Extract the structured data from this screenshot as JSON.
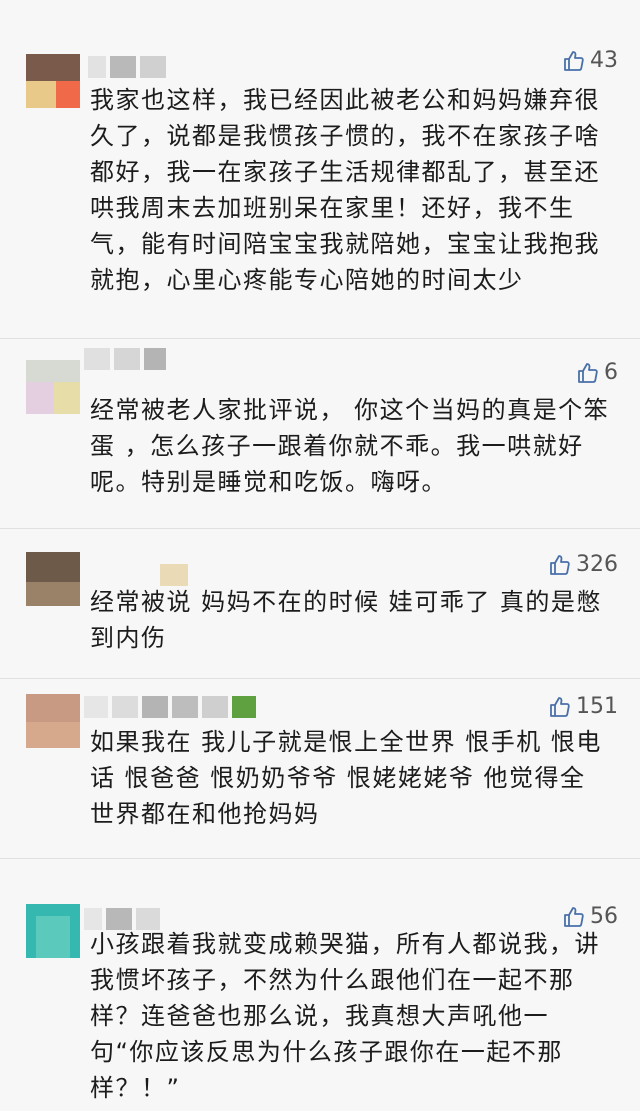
{
  "comments": [
    {
      "likes": "43",
      "text": "我家也这样，我已经因此被老公和妈妈嫌弃很久了，说都是我惯孩子惯的，我不在家孩子啥都好，我一在家孩子生活规律都乱了，甚至还哄我周末去加班别呆在家里！还好，我不生气，能有时间陪宝宝我就陪她，宝宝让我抱我就抱，心里心疼能专心陪她的时间太少"
    },
    {
      "likes": "6",
      "text": "经常被老人家批评说， 你这个当妈的真是个笨蛋 ，怎么孩子一跟着你就不乖。我一哄就好呢。特别是睡觉和吃饭。嗨呀。"
    },
    {
      "likes": "326",
      "text": "经常被说 妈妈不在的时候 娃可乖了 真的是憋到内伤"
    },
    {
      "likes": "151",
      "text": "如果我在 我儿子就是恨上全世界 恨手机 恨电话 恨爸爸 恨奶奶爷爷 恨姥姥姥爷 他觉得全世界都在和他抢妈妈"
    },
    {
      "likes": "56",
      "text": "小孩跟着我就变成赖哭猫，所有人都说我，讲我惯坏孩子，不然为什么跟他们在一起不那样？连爸爸也那么说，我真想大声吼他一句“你应该反思为什么孩子跟你在一起不那样？！”"
    }
  ],
  "icons": {
    "like": "thumbs-up-icon"
  }
}
